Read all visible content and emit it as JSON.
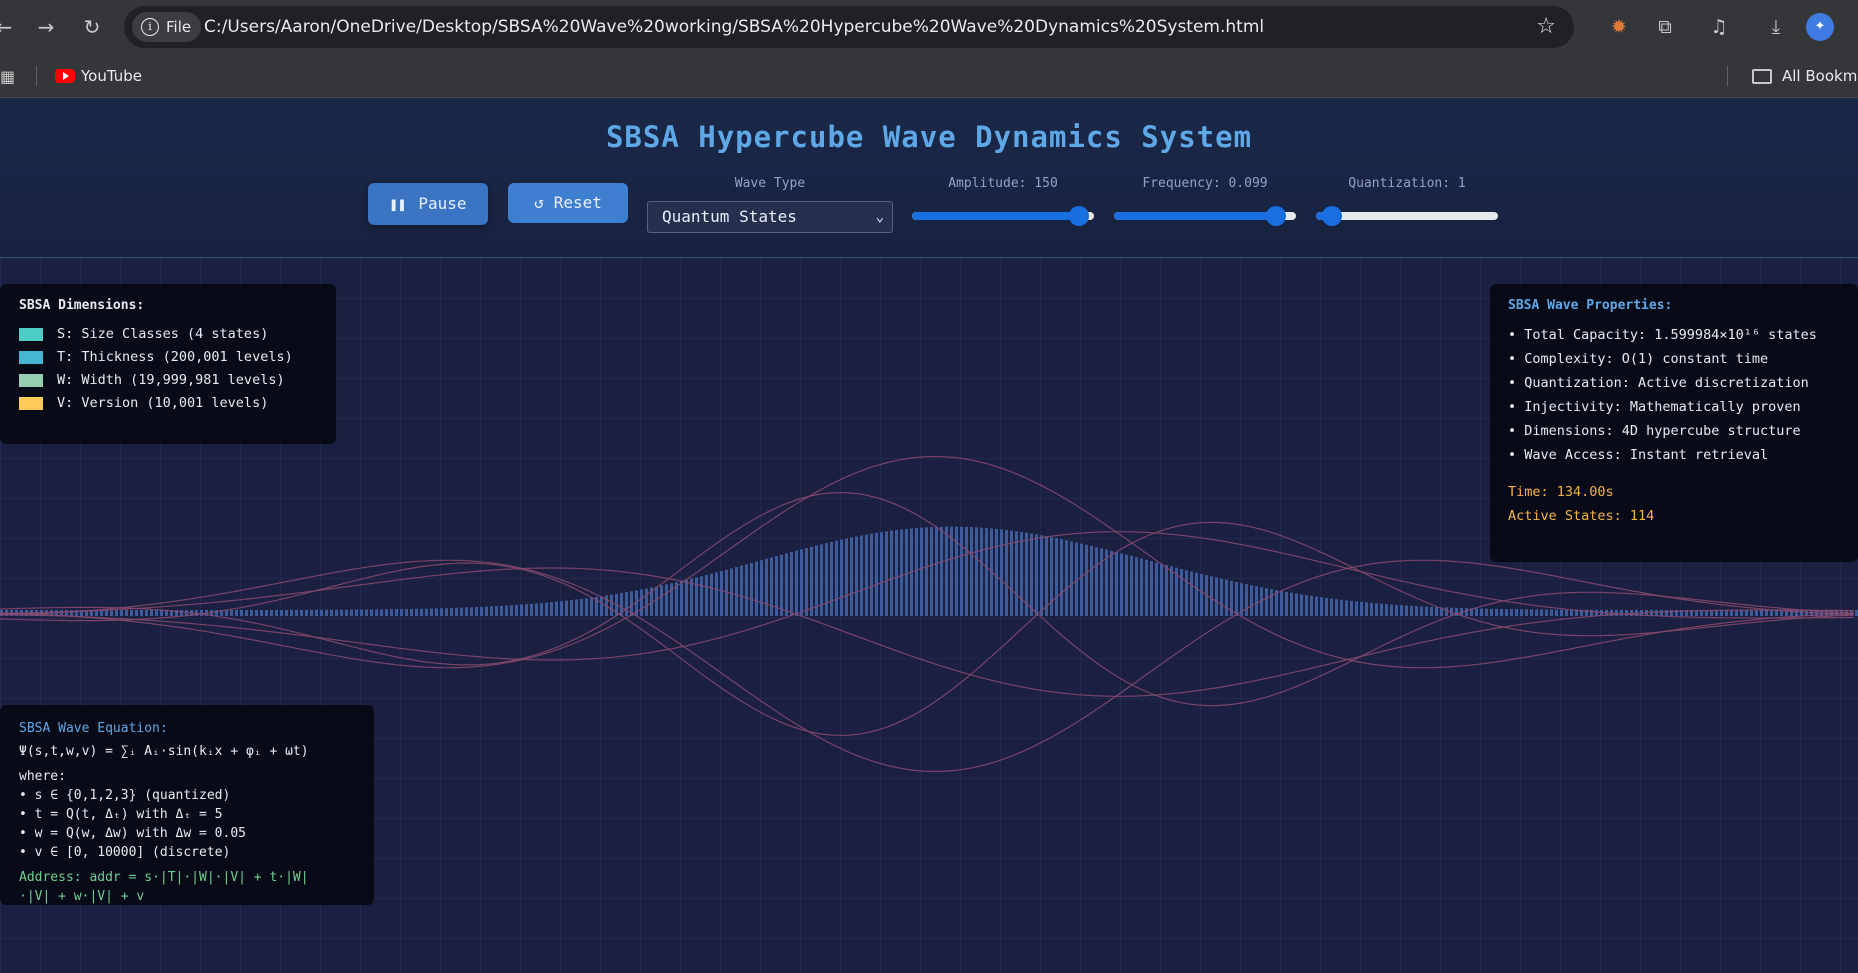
{
  "browser": {
    "file_chip": "File",
    "url": "C:/Users/Aaron/OneDrive/Desktop/SBSA%20Wave%20working/SBSA%20Hypercube%20Wave%20Dynamics%20System.html",
    "bookmarks": [
      "YouTube"
    ],
    "all_bookmarks": "All Bookma"
  },
  "app": {
    "title": "SBSA Hypercube Wave Dynamics System",
    "controls": {
      "pause_label": "Pause",
      "reset_label": "Reset",
      "wave_type_label": "Wave Type",
      "wave_type_value": "Quantum States",
      "amplitude_label": "Amplitude: 150",
      "frequency_label": "Frequency: 0.099",
      "quantization_label": "Quantization: 1",
      "amplitude_fraction": 0.92,
      "frequency_fraction": 0.89,
      "quantization_fraction": 0.09
    },
    "dimensions_panel": {
      "title": "SBSA Dimensions:",
      "items": [
        {
          "label": "S: Size Classes (4 states)",
          "color": "#4ecdc4"
        },
        {
          "label": "T: Thickness (200,001 levels)",
          "color": "#45b7d1"
        },
        {
          "label": "W: Width (19,999,981 levels)",
          "color": "#96ceb4"
        },
        {
          "label": "V: Version (10,001 levels)",
          "color": "#feca57"
        }
      ]
    },
    "properties_panel": {
      "title": "SBSA Wave Properties:",
      "items": [
        "• Total Capacity: 1.599984×10¹⁶ states",
        "• Complexity: O(1) constant time",
        "• Quantization: Active discretization",
        "• Injectivity: Mathematically proven",
        "• Dimensions: 4D hypercube structure",
        "• Wave Access: Instant retrieval"
      ],
      "time": "Time: 134.00s",
      "active_states": "Active States: 114"
    },
    "equation_panel": {
      "title": "SBSA Wave Equation:",
      "equation": "Ψ(s,t,w,v) = ∑ᵢ Aᵢ·sin(kᵢx + φᵢ + ωt)",
      "where": "where:",
      "lines": [
        "• s ∈ {0,1,2,3} (quantized)",
        "• t = Q(t, Δₜ) with Δₜ = 5",
        "• w = Q(w, Δw) with Δw = 0.05",
        "• v ∈ [0, 10000] (discrete)"
      ],
      "address_1": "Address: addr = s·|T|·|W|·|V| + t·|W|",
      "address_2": "·|V| + w·|V| + v"
    },
    "colors": {
      "accent": "#5fa8e8",
      "wave_lines": "#8a4a6e",
      "bars": "#4a6fb8",
      "green_text": "#6fcf8f",
      "orange_text": "#f5b342"
    }
  }
}
